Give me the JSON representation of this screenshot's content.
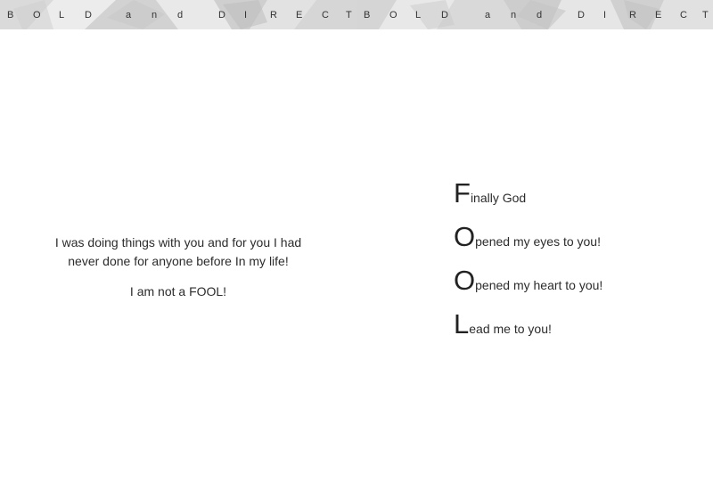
{
  "header": {
    "left_letters": [
      "B",
      "O",
      "L",
      "D",
      "a",
      "n",
      "d",
      "D",
      "I",
      "R",
      "E",
      "C",
      "T"
    ],
    "right_letters": [
      "B",
      "O",
      "L",
      "D",
      "a",
      "n",
      "d",
      "D",
      "I",
      "R",
      "E",
      "C",
      "T"
    ]
  },
  "left_page": {
    "paragraph_line_1": "I was doing things with you and for you I had",
    "paragraph_line_2": "never done for anyone before In my life!",
    "closing": "I am not a FOOL!"
  },
  "acrostic": [
    {
      "initial": "F",
      "rest": "inally God"
    },
    {
      "initial": "O",
      "rest": "pened my eyes to you!"
    },
    {
      "initial": "O",
      "rest": "pened my heart to you!"
    },
    {
      "initial": "L",
      "rest": "ead me to you!"
    }
  ],
  "colors": {
    "band_base": "#e6e6e6",
    "text": "#2c2c2c"
  }
}
